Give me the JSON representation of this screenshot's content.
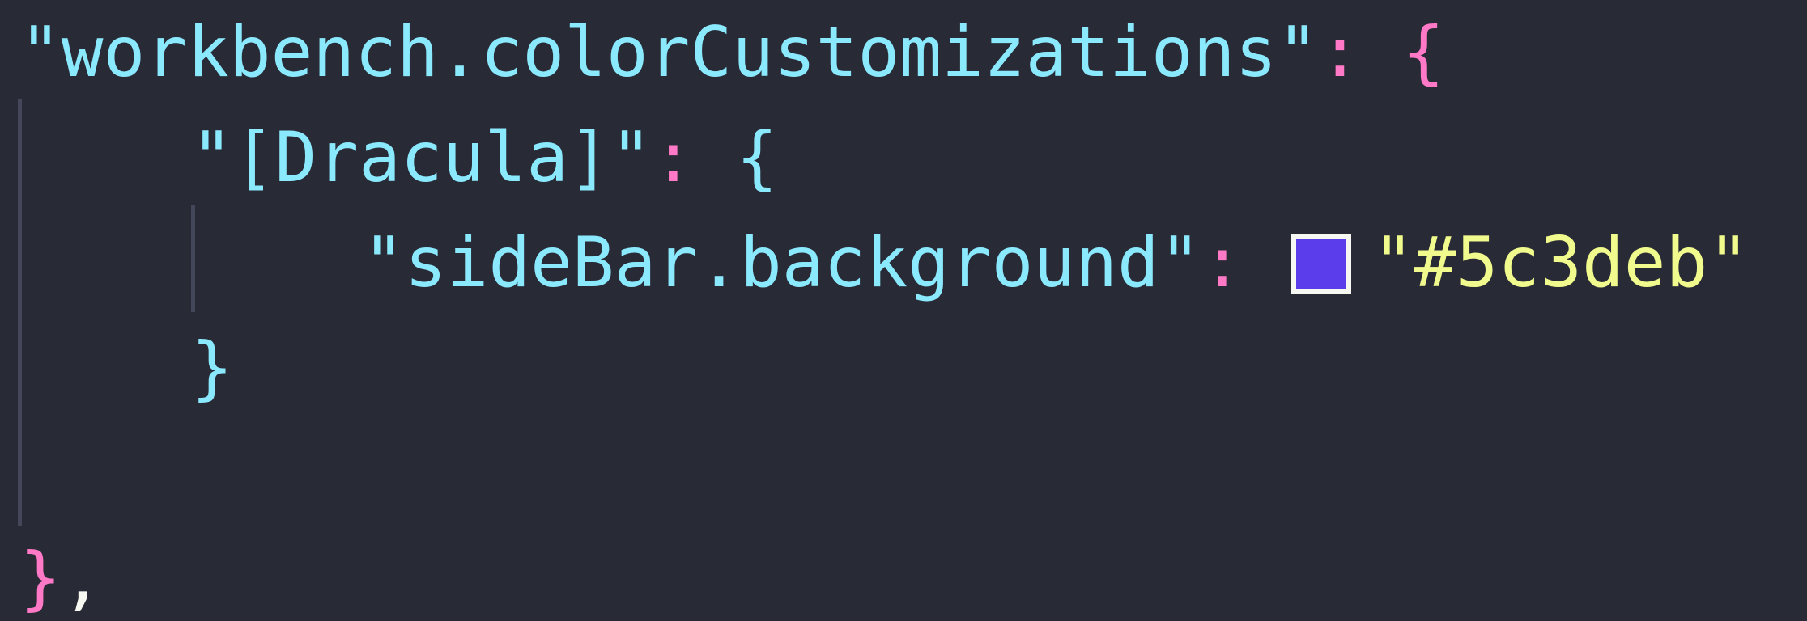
{
  "editor": {
    "line1": {
      "key": "\"workbench.colorCustomizations\"",
      "colon": ":",
      "open": "{"
    },
    "line2": {
      "key": "\"[Dracula]\"",
      "colon": ":",
      "open": "{"
    },
    "line3": {
      "key": "\"sideBar.background\"",
      "colon": ":",
      "swatch_color": "#5c3deb",
      "value": "\"#5c3deb\""
    },
    "line4": {
      "close": "}"
    },
    "line6": {
      "close": "}",
      "comma": ","
    }
  },
  "colors": {
    "background": "#282a36",
    "key": "#8be9fd",
    "punctuation": "#ff79c6",
    "string_value": "#f1fa8c"
  }
}
